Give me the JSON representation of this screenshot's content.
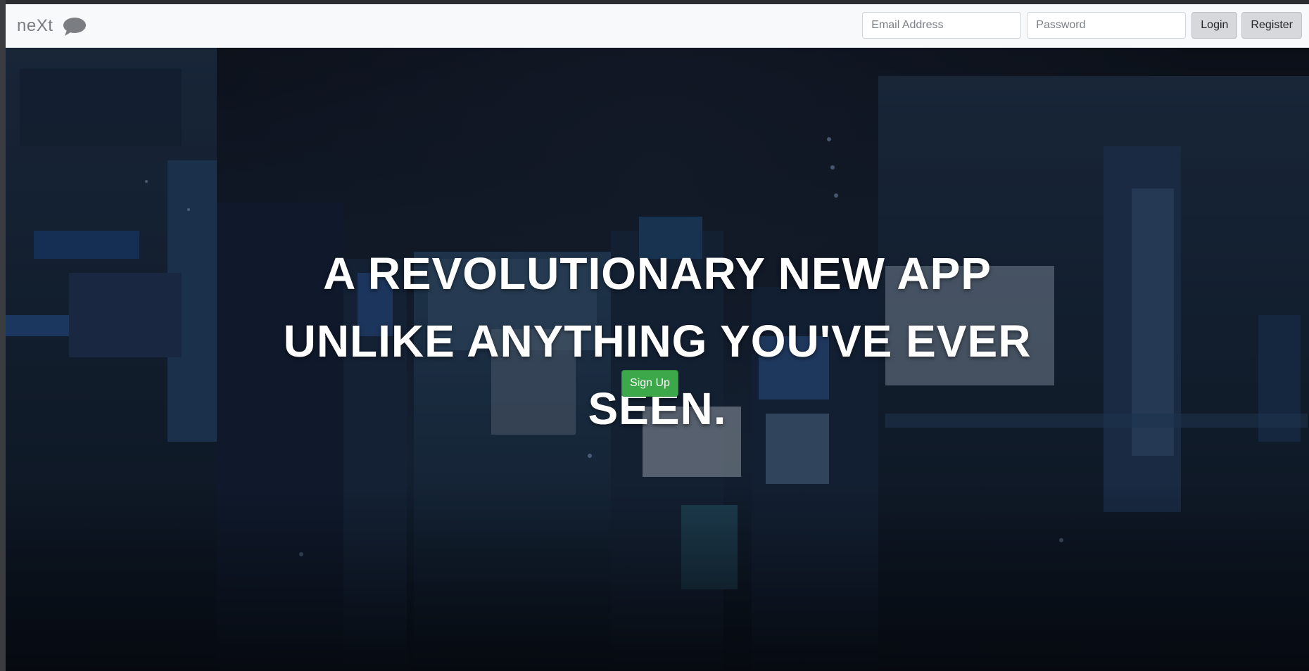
{
  "navbar": {
    "brand": "neXt",
    "brand_icon": "speech-bubble-icon",
    "email_placeholder": "Email Address",
    "password_placeholder": "Password",
    "login_label": "Login",
    "register_label": "Register"
  },
  "hero": {
    "title_lines": [
      "A REVOLUTIONARY NEW APP",
      "UNLIKE ANYTHING YOU'VE EVER",
      "SEEN."
    ],
    "signup_label": "Sign Up",
    "background_image": "city-night-street-photo"
  },
  "colors": {
    "navbar_bg": "#f8f9fa",
    "signup_green": "#3da84a",
    "button_gray": "#d6d8db",
    "title_white": "#ffffff"
  }
}
